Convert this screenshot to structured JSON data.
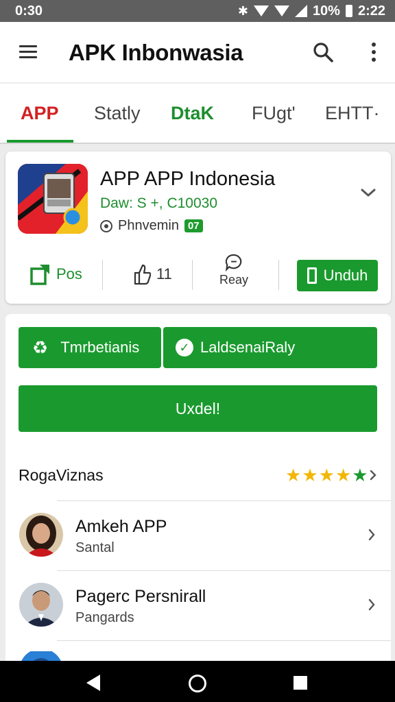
{
  "status_bar": {
    "time_left": "0:30",
    "battery": "10%",
    "time_right": "2:22"
  },
  "app_bar": {
    "title": "APK Inbonwasia"
  },
  "tabs": [
    {
      "label": "APP",
      "active": true
    },
    {
      "label": "Statly"
    },
    {
      "label": "DtaK"
    },
    {
      "label": "FUgt'"
    },
    {
      "label": "EHTT·"
    }
  ],
  "app_card": {
    "name": "APP APP Indonesia",
    "subtitle": "Daw: S +, C10030",
    "developer": "Phnvemin",
    "badge": "07",
    "actions": {
      "pos_label": "Pos",
      "like_label": "11",
      "review_label": "Reay",
      "download_label": "Unduh"
    }
  },
  "content": {
    "button_1": "Tmrbetianis",
    "button_2": "LaldsenaiRaly",
    "button_big": "Uxdel!",
    "section_title": "RogaViznas",
    "rating": {
      "filled": 5,
      "max": 5
    },
    "list": [
      {
        "title": "Amkeh APP",
        "subtitle": "Santal"
      },
      {
        "title": "Pagerc Persnirall",
        "subtitle": "Pangards"
      }
    ]
  },
  "colors": {
    "accent": "#1a9a2e",
    "tab_active": "#d32020",
    "star": "#f2b705"
  }
}
